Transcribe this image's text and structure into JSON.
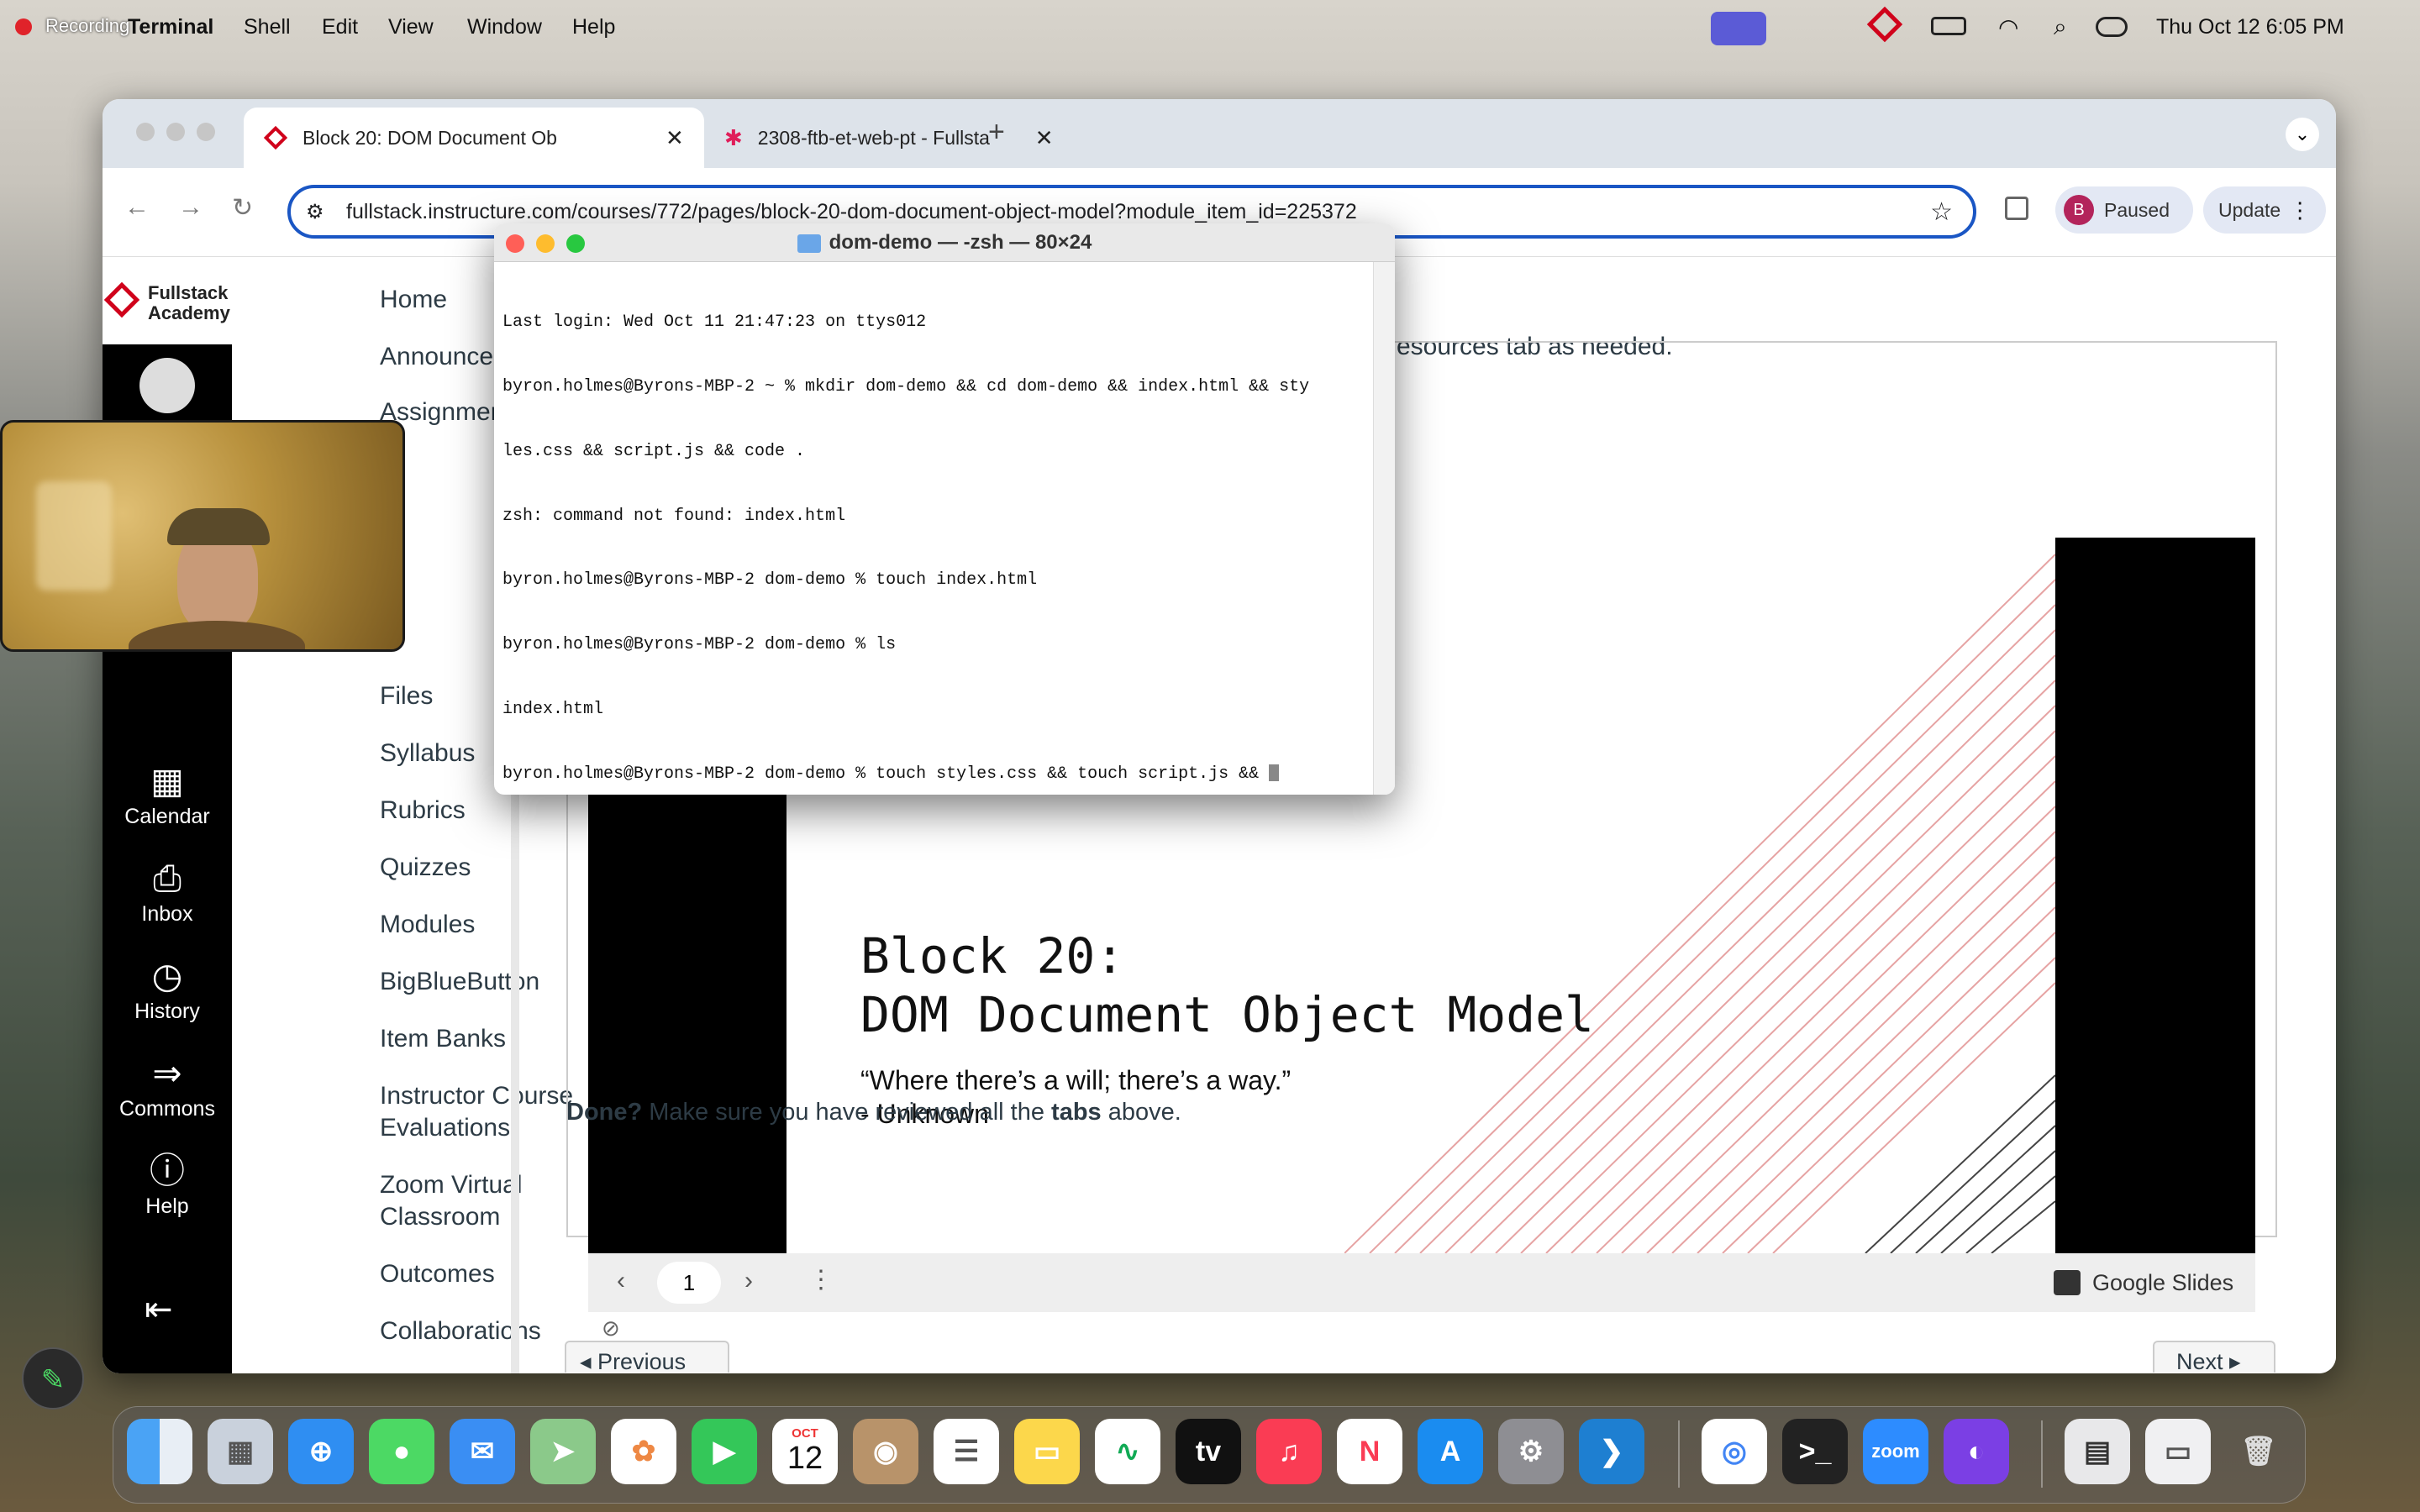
{
  "menubar": {
    "recording_label": "Recording",
    "app_name": "Terminal",
    "items": [
      "Shell",
      "Edit",
      "View",
      "Window",
      "Help"
    ],
    "datetime": "Thu Oct 12  6:05 PM"
  },
  "browser": {
    "tabs": [
      {
        "label": "Block 20: DOM Document Ob",
        "active": true
      },
      {
        "label": "2308-ftb-et-web-pt - Fullsta",
        "active": false
      }
    ],
    "url": "fullstack.instructure.com/courses/772/pages/block-20-dom-document-object-model?module_item_id=225372",
    "profile_initial": "B",
    "profile_status": "Paused",
    "update_label": "Update"
  },
  "canvas": {
    "logo_line1": "Fullstack",
    "logo_line2": "Academy",
    "global_nav": [
      {
        "label": "Calendar",
        "icon": "calendar-icon"
      },
      {
        "label": "Inbox",
        "icon": "inbox-icon"
      },
      {
        "label": "History",
        "icon": "history-icon"
      },
      {
        "label": "Commons",
        "icon": "commons-icon"
      },
      {
        "label": "Help",
        "icon": "help-icon"
      }
    ],
    "course_nav": {
      "home": "Home",
      "announcements": "Announcements",
      "assignments": "Assignments",
      "files": "Files",
      "syllabus": "Syllabus",
      "rubrics": "Rubrics",
      "quizzes": "Quizzes",
      "modules": "Modules",
      "bigbluebutton": "BigBlueButton",
      "item_banks": "Item Banks",
      "instructor_eval_1": "Instructor Course",
      "instructor_eval_2": "Evaluations",
      "zoom_1": "Zoom Virtual",
      "zoom_2": "Classroom",
      "outcomes": "Outcomes",
      "collaborations": "Collaborations"
    },
    "resources_fragment": "esources tab as needed.",
    "slide": {
      "title_line1": "Block 20:",
      "title_line2": "DOM Document Object Model",
      "quote": "“Where there’s a will; there’s a way.”",
      "author": "-  Unknown",
      "page_number": "1",
      "provider": "Google Slides"
    },
    "done_bold": "Done?",
    "done_text1": " Make sure you have reviewed all the ",
    "done_bold2": "tabs",
    "done_text2": " above.",
    "previous_label": "◂ Previous",
    "next_label": "Next ▸"
  },
  "terminal": {
    "title": "dom-demo — -zsh — 80×24",
    "lines": [
      "Last login: Wed Oct 11 21:47:23 on ttys012",
      "byron.holmes@Byrons-MBP-2 ~ % mkdir dom-demo && cd dom-demo && index.html && sty",
      "les.css && script.js && code .",
      "zsh: command not found: index.html",
      "byron.holmes@Byrons-MBP-2 dom-demo % touch index.html",
      "byron.holmes@Byrons-MBP-2 dom-demo % ls",
      "index.html",
      "byron.holmes@Byrons-MBP-2 dom-demo % touch styles.css && touch script.js && "
    ]
  },
  "dock": {
    "calendar_month": "OCT",
    "calendar_day": "12",
    "tv_label": "tv",
    "zoom_label": "zoom"
  },
  "colors": {
    "accent_blue": "#1a56c4",
    "fullstack_red": "#d0021b",
    "canvas_black": "#000000"
  }
}
